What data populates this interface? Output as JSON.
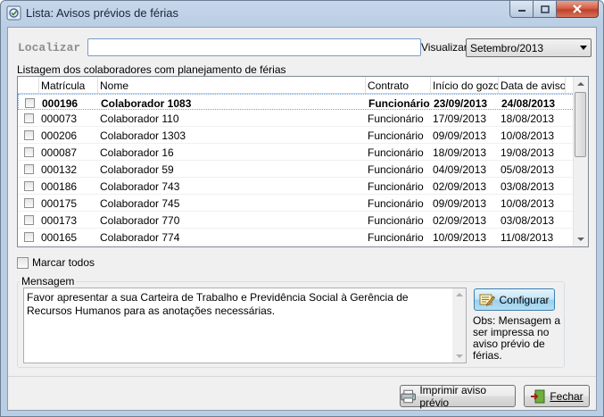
{
  "window": {
    "title": "Lista: Avisos prévios de férias",
    "icon": "list-app-icon"
  },
  "filter": {
    "localizar_label": "Localizar",
    "localizar_value": "",
    "visualizar_label": "Visualizar",
    "visualizar_value": "Setembro/2013"
  },
  "grid": {
    "caption": "Listagem dos colaboradores com planejamento de férias",
    "columns": [
      "",
      "Matrícula",
      "Nome",
      "Contrato",
      "Início do gozo",
      "Data de aviso"
    ],
    "rows": [
      {
        "matricula": "000196",
        "nome": "Colaborador 1083",
        "contrato": "Funcionário",
        "inicio": "23/09/2013",
        "aviso": "24/08/2013",
        "selected": true
      },
      {
        "matricula": "000073",
        "nome": "Colaborador 110",
        "contrato": "Funcionário",
        "inicio": "17/09/2013",
        "aviso": "18/08/2013"
      },
      {
        "matricula": "000206",
        "nome": "Colaborador 1303",
        "contrato": "Funcionário",
        "inicio": "09/09/2013",
        "aviso": "10/08/2013"
      },
      {
        "matricula": "000087",
        "nome": "Colaborador 16",
        "contrato": "Funcionário",
        "inicio": "18/09/2013",
        "aviso": "19/08/2013"
      },
      {
        "matricula": "000132",
        "nome": "Colaborador 59",
        "contrato": "Funcionário",
        "inicio": "04/09/2013",
        "aviso": "05/08/2013"
      },
      {
        "matricula": "000186",
        "nome": "Colaborador 743",
        "contrato": "Funcionário",
        "inicio": "02/09/2013",
        "aviso": "03/08/2013"
      },
      {
        "matricula": "000175",
        "nome": "Colaborador 745",
        "contrato": "Funcionário",
        "inicio": "09/09/2013",
        "aviso": "10/08/2013"
      },
      {
        "matricula": "000173",
        "nome": "Colaborador 770",
        "contrato": "Funcionário",
        "inicio": "02/09/2013",
        "aviso": "03/08/2013"
      },
      {
        "matricula": "000165",
        "nome": "Colaborador 774",
        "contrato": "Funcionário",
        "inicio": "10/09/2013",
        "aviso": "11/08/2013"
      }
    ]
  },
  "marcar_todos": "Marcar todos",
  "mensagem": {
    "legend": "Mensagem",
    "text": "Favor apresentar a sua Carteira de Trabalho e Previdência Social à Gerência de Recursos Humanos para as anotações necessárias.",
    "configurar_label": "Configurar",
    "obs": "Obs: Mensagem a ser impressa no aviso prévio de férias."
  },
  "buttons": {
    "imprimir": "Imprimir aviso prévio",
    "fechar": "Fechar"
  }
}
